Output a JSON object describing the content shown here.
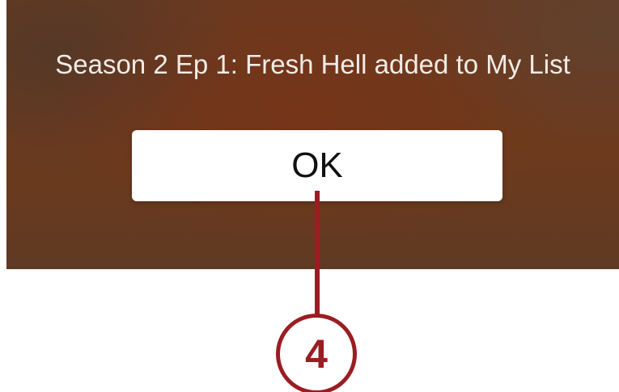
{
  "alert": {
    "message": "Season 2 Ep 1: Fresh Hell added to My List",
    "ok_label": "OK"
  },
  "callout": {
    "number": "4"
  },
  "colors": {
    "callout_accent": "#9a1d22",
    "panel_background": "#6a3a20",
    "button_background": "#ffffff"
  }
}
